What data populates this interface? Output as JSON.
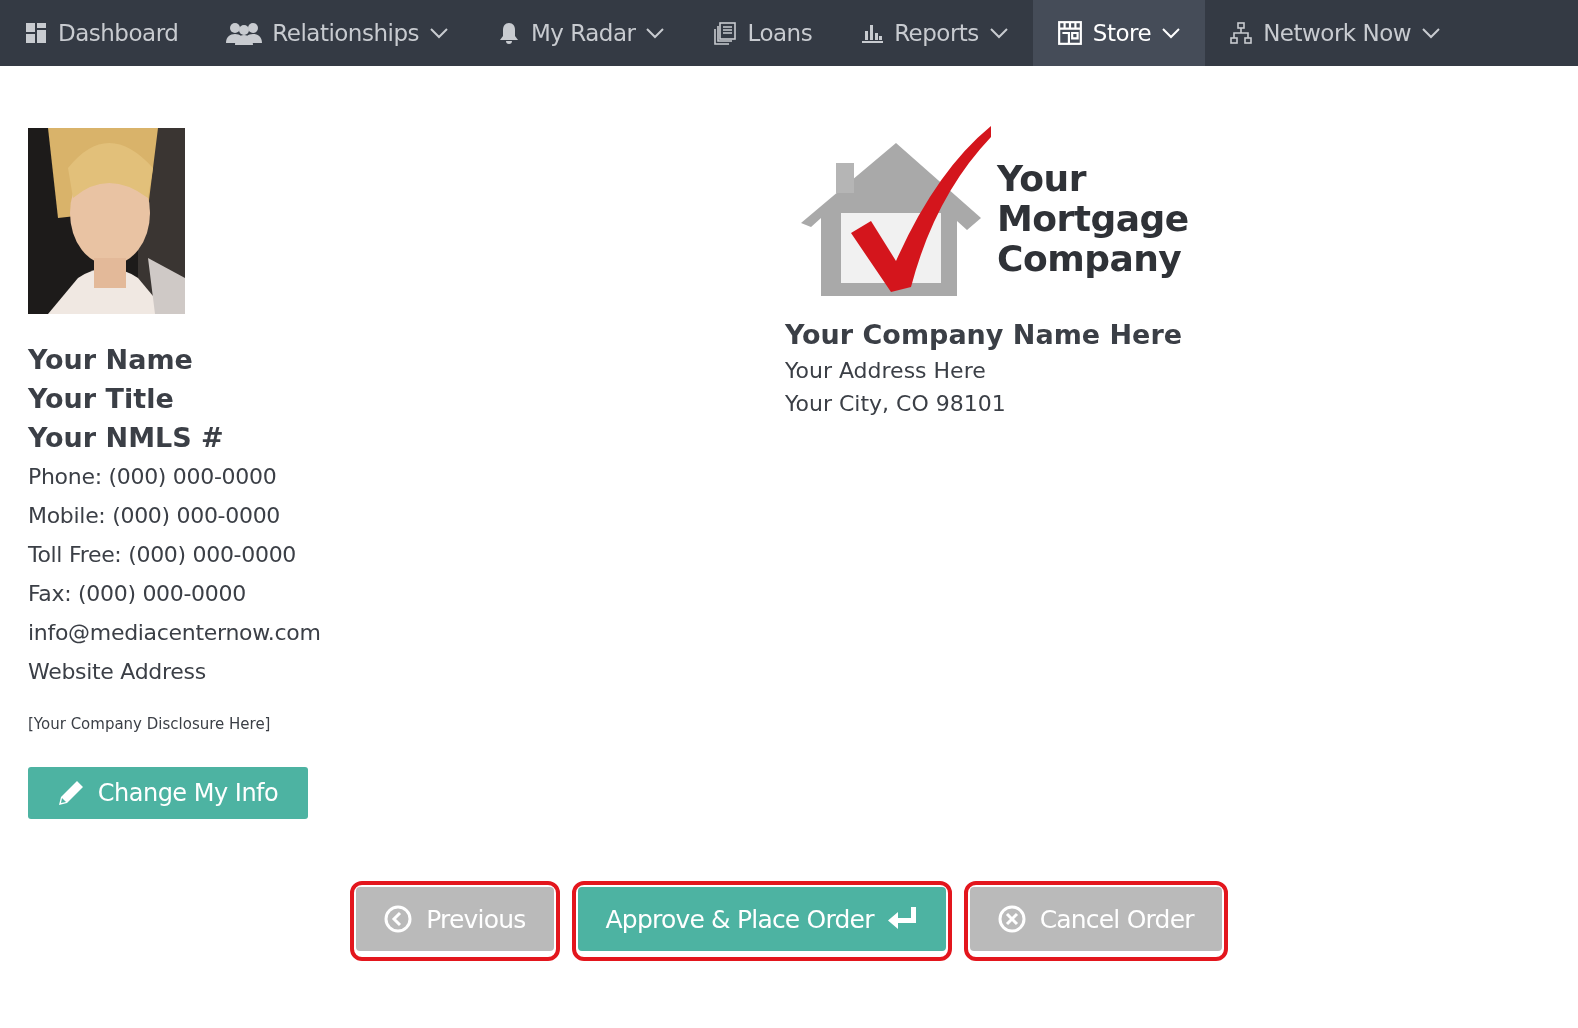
{
  "nav": {
    "items": [
      {
        "label": "Dashboard",
        "kind": "grid",
        "dropdown": false,
        "selected": false
      },
      {
        "label": "Relationships",
        "kind": "people",
        "dropdown": true,
        "selected": false
      },
      {
        "label": "My Radar",
        "kind": "bell",
        "dropdown": true,
        "selected": false
      },
      {
        "label": "Loans",
        "kind": "papers",
        "dropdown": false,
        "selected": false
      },
      {
        "label": "Reports",
        "kind": "chart",
        "dropdown": true,
        "selected": false
      },
      {
        "label": "Store",
        "kind": "store",
        "dropdown": true,
        "selected": true
      },
      {
        "label": "Network Now",
        "kind": "network",
        "dropdown": true,
        "selected": false
      }
    ]
  },
  "contact": {
    "photo": {
      "kind": "picture"
    },
    "headings": [
      "Your Name",
      "Your Title",
      "Your NMLS #"
    ],
    "lines": [
      "Phone: (000) 000-0000",
      "Mobile: (000) 000-0000",
      "Toll Free: (000) 000-0000",
      "Fax: (000) 000-0000",
      "info@mediacenternow.com",
      "Website Address"
    ],
    "disclosure": "[Your Company Disclosure Here]",
    "change_button": "Change My Info"
  },
  "company": {
    "logo_text": [
      "Your",
      "Mortgage",
      "Company"
    ],
    "name": "Your Company Name Here",
    "address_lines": [
      "Your Address Here",
      "Your City, CO 98101"
    ]
  },
  "actions": [
    {
      "label": "Previous",
      "kind": "previous",
      "highlighted": true
    },
    {
      "label": "Approve & Place Order",
      "kind": "approve",
      "highlighted": true
    },
    {
      "label": "Cancel Order",
      "kind": "cancel",
      "highlighted": true
    }
  ]
}
